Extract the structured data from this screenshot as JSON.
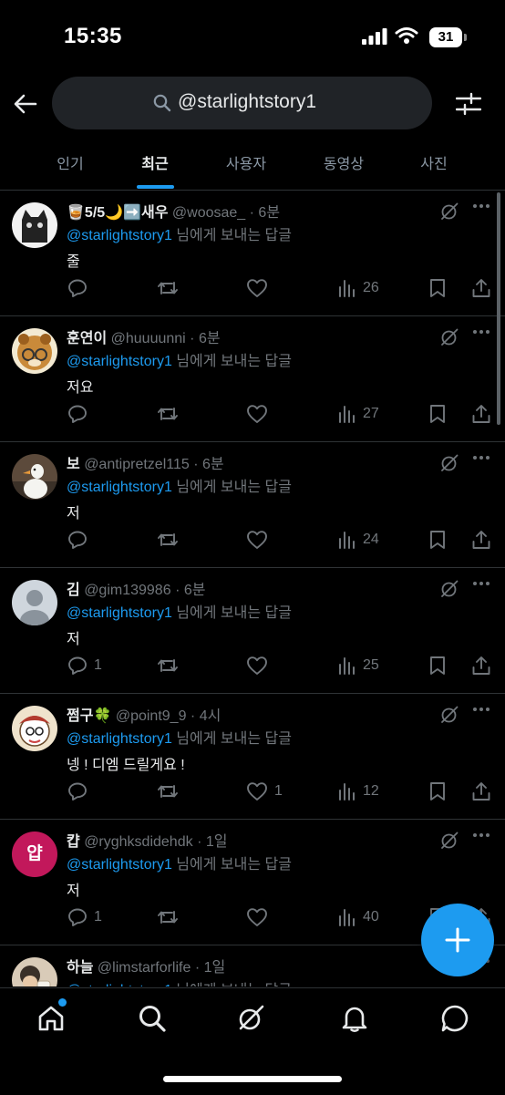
{
  "status_bar": {
    "time": "15:35",
    "battery": "31"
  },
  "search": {
    "query": "@starlightstory1"
  },
  "tabs": [
    {
      "label": "인기",
      "active": false
    },
    {
      "label": "최근",
      "active": true
    },
    {
      "label": "사용자",
      "active": false
    },
    {
      "label": "동영상",
      "active": false
    },
    {
      "label": "사진",
      "active": false
    }
  ],
  "reply_to": {
    "mention": "@starlightstory1",
    "suffix": "님에게 보내는 답글"
  },
  "posts": [
    {
      "name": "🥃5/5🌙➡️새우",
      "handle": "@woosae_",
      "time": "· 6분",
      "text": "줄",
      "replies": "",
      "likes": "",
      "views": "26"
    },
    {
      "name": "훈연이",
      "handle": "@huuuunni",
      "time": "· 6분",
      "text": "저요",
      "replies": "",
      "likes": "",
      "views": "27"
    },
    {
      "name": "보",
      "handle": "@antipretzel115",
      "time": "· 6분",
      "text": "저",
      "replies": "",
      "likes": "",
      "views": "24"
    },
    {
      "name": "김",
      "handle": "@gim139986",
      "time": "· 6분",
      "text": "저",
      "replies": "1",
      "likes": "",
      "views": "25"
    },
    {
      "name": "쩜구🍀",
      "handle": "@point9_9",
      "time": "· 4시",
      "text": "넹 ! 디엠 드릴게요 !",
      "replies": "",
      "likes": "1",
      "views": "12"
    },
    {
      "name": "캽",
      "handle": "@ryghksdidehdk",
      "time": "· 1일",
      "text": "저",
      "replies": "1",
      "likes": "",
      "views": "40",
      "avatar_letter": "얍"
    },
    {
      "name": "하늘",
      "handle": "@limstarforlife",
      "time": "· 1일",
      "text": "",
      "replies": "",
      "likes": "",
      "views": ""
    }
  ],
  "colors": {
    "accent": "#1d9bf0",
    "muted": "#71767b",
    "text": "#e7e9ea",
    "border": "#2f3336",
    "search_bg": "#202327"
  },
  "icons": [
    "back-arrow-icon",
    "search-icon",
    "filter-sliders-icon",
    "grok-icon",
    "more-icon",
    "reply-icon",
    "retweet-icon",
    "like-icon",
    "views-icon",
    "bookmark-icon",
    "share-icon",
    "compose-plus-icon",
    "home-icon",
    "explore-icon",
    "notifications-icon",
    "messages-icon"
  ]
}
